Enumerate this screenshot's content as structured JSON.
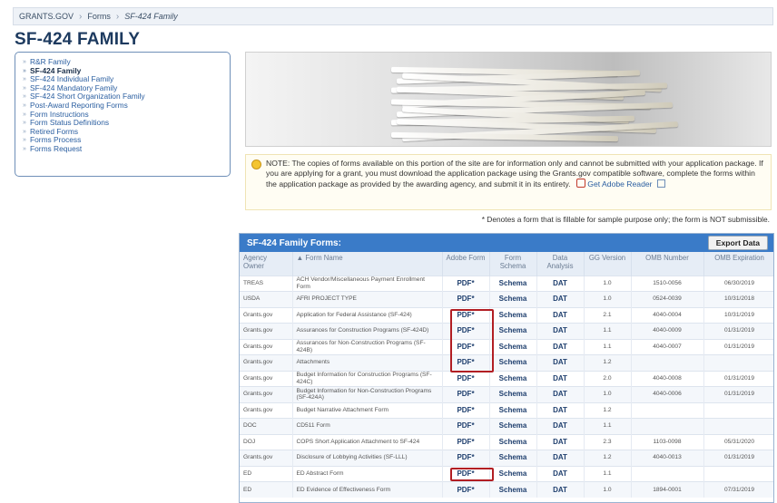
{
  "breadcrumb": {
    "items": [
      "GRANTS.GOV",
      "Forms",
      "SF-424 Family"
    ],
    "separator": "›"
  },
  "page_title": "SF-424 FAMILY",
  "sidebar": {
    "items": [
      {
        "label": "R&R Family",
        "active": false
      },
      {
        "label": "SF-424 Family",
        "active": true
      },
      {
        "label": "SF-424 Individual Family",
        "active": false
      },
      {
        "label": "SF-424 Mandatory Family",
        "active": false
      },
      {
        "label": "SF-424 Short Organization Family",
        "active": false
      },
      {
        "label": "Post-Award Reporting Forms",
        "active": false
      },
      {
        "label": "Form Instructions",
        "active": false
      },
      {
        "label": "Form Status Definitions",
        "active": false
      },
      {
        "label": "Retired Forms",
        "active": false
      },
      {
        "label": "Forms Process",
        "active": false
      },
      {
        "label": "Forms Request",
        "active": false
      }
    ]
  },
  "note": {
    "text": "NOTE: The copies of forms available on this portion of the site are for information only and cannot be submitted with your application package. If you are applying for a grant, you must download the application package using the Grants.gov compatible software, complete the forms within the application package as provided by the awarding agency, and submit it in its entirety.",
    "adobe_link": "Get Adobe Reader"
  },
  "footnote": "* Denotes a form that is fillable for sample purpose only; the form is NOT submissible.",
  "forms_table": {
    "title": "SF-424 Family Forms:",
    "export_label": "Export Data",
    "columns": [
      "Agency Owner",
      "▲ Form Name",
      "Adobe Form",
      "Form Schema",
      "Data Analysis",
      "GG Version",
      "OMB Number",
      "OMB Expiration"
    ],
    "rows": [
      {
        "agency": "TREAS",
        "name": "ACH Vendor/Miscellaneous Payment Enrollment Form",
        "pdf": "PDF*",
        "schema": "Schema",
        "dat": "DAT",
        "version": "1.0",
        "omb": "1510-0056",
        "exp": "06/30/2019"
      },
      {
        "agency": "USDA",
        "name": "AFRI PROJECT TYPE",
        "pdf": "PDF*",
        "schema": "Schema",
        "dat": "DAT",
        "version": "1.0",
        "omb": "0524-0039",
        "exp": "10/31/2018"
      },
      {
        "agency": "Grants.gov",
        "name": "Application for Federal Assistance (SF-424)",
        "pdf": "PDF*",
        "schema": "Schema",
        "dat": "DAT",
        "version": "2.1",
        "omb": "4040-0004",
        "exp": "10/31/2019"
      },
      {
        "agency": "Grants.gov",
        "name": "Assurances for Construction Programs (SF-424D)",
        "pdf": "PDF*",
        "schema": "Schema",
        "dat": "DAT",
        "version": "1.1",
        "omb": "4040-0009",
        "exp": "01/31/2019"
      },
      {
        "agency": "Grants.gov",
        "name": "Assurances for Non-Construction Programs (SF-424B)",
        "pdf": "PDF*",
        "schema": "Schema",
        "dat": "DAT",
        "version": "1.1",
        "omb": "4040-0007",
        "exp": "01/31/2019"
      },
      {
        "agency": "Grants.gov",
        "name": "Attachments",
        "pdf": "PDF*",
        "schema": "Schema",
        "dat": "DAT",
        "version": "1.2",
        "omb": "",
        "exp": ""
      },
      {
        "agency": "Grants.gov",
        "name": "Budget Information for Construction Programs (SF-424C)",
        "pdf": "PDF*",
        "schema": "Schema",
        "dat": "DAT",
        "version": "2.0",
        "omb": "4040-0008",
        "exp": "01/31/2019"
      },
      {
        "agency": "Grants.gov",
        "name": "Budget Information for Non-Construction Programs (SF-424A)",
        "pdf": "PDF*",
        "schema": "Schema",
        "dat": "DAT",
        "version": "1.0",
        "omb": "4040-0006",
        "exp": "01/31/2019"
      },
      {
        "agency": "Grants.gov",
        "name": "Budget Narrative Attachment Form",
        "pdf": "PDF*",
        "schema": "Schema",
        "dat": "DAT",
        "version": "1.2",
        "omb": "",
        "exp": ""
      },
      {
        "agency": "DOC",
        "name": "CD511 Form",
        "pdf": "PDF*",
        "schema": "Schema",
        "dat": "DAT",
        "version": "1.1",
        "omb": "",
        "exp": ""
      },
      {
        "agency": "DOJ",
        "name": "COPS Short Application Attachment to SF-424",
        "pdf": "PDF*",
        "schema": "Schema",
        "dat": "DAT",
        "version": "2.3",
        "omb": "1103-0098",
        "exp": "05/31/2020"
      },
      {
        "agency": "Grants.gov",
        "name": "Disclosure of Lobbying Activities (SF-LLL)",
        "pdf": "PDF*",
        "schema": "Schema",
        "dat": "DAT",
        "version": "1.2",
        "omb": "4040-0013",
        "exp": "01/31/2019"
      },
      {
        "agency": "ED",
        "name": "ED Abstract Form",
        "pdf": "PDF*",
        "schema": "Schema",
        "dat": "DAT",
        "version": "1.1",
        "omb": "",
        "exp": ""
      },
      {
        "agency": "ED",
        "name": "ED Evidence of Effectiveness Form",
        "pdf": "PDF*",
        "schema": "Schema",
        "dat": "DAT",
        "version": "1.0",
        "omb": "1894-0001",
        "exp": "07/31/2019"
      }
    ]
  },
  "colors": {
    "header_blue": "#3a7bc8",
    "highlight_red": "#b21e23",
    "link_blue": "#2a5ea0"
  }
}
